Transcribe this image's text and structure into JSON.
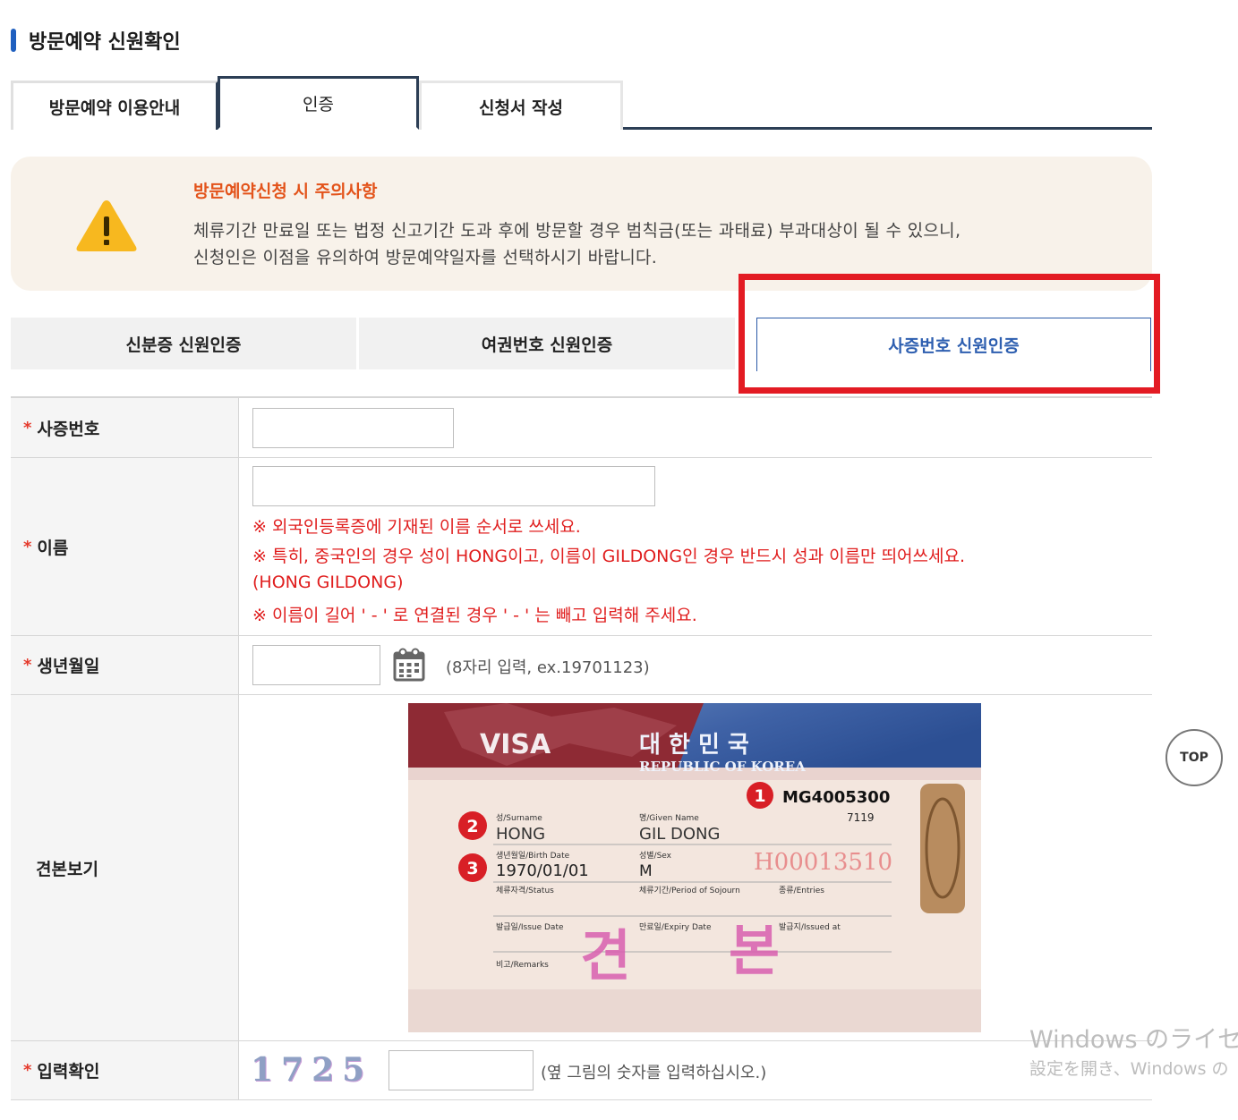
{
  "page_title": "방문예약 신원확인",
  "tabs": [
    {
      "label": "방문예약 이용안내"
    },
    {
      "label": "인증"
    },
    {
      "label": "신청서 작성"
    }
  ],
  "notice": {
    "title": "방문예약신청 시 주의사항",
    "line1": "체류기간 만료일 또는 법정 신고기간 도과 후에 방문할 경우 범칙금(또는 과태료) 부과대상이 될 수 있으니,",
    "line2": "신청인은 이점을 유의하여 방문예약일자를 선택하시기 바랍니다."
  },
  "auth_tabs": [
    {
      "label": "신분증 신원인증"
    },
    {
      "label": "여권번호 신원인증"
    },
    {
      "label": "사증번호 신원인증"
    }
  ],
  "form": {
    "required_mark": "*",
    "visa_number": {
      "label": "사증번호",
      "value": ""
    },
    "name": {
      "label": "이름",
      "value": "",
      "hint1": "※ 외국인등록증에 기재된 이름 순서로 쓰세요.",
      "hint2": "※ 특히, 중국인의 경우 성이 HONG이고, 이름이 GILDONG인 경우 반드시 성과 이름만 띄어쓰세요.",
      "hint3": "(HONG GILDONG)",
      "hint4": "※ 이름이 길어 ' - ' 로 연결된 경우 ' - ' 는 빼고 입력해 주세요."
    },
    "birth": {
      "label": "생년월일",
      "value": "",
      "hint": "(8자리 입력, ex.19701123)",
      "icon": "calendar-icon"
    },
    "sample": {
      "label": "견본보기",
      "visa": {
        "visa_word": "VISA",
        "country_kr": "대 한 민 국",
        "country_en": "REPUBLIC OF KOREA",
        "number": "MG4005300",
        "sub_number": "7119",
        "surname_label": "성/Surname",
        "surname": "HONG",
        "given_label": "명/Given Name",
        "given": "GIL DONG",
        "birth_label": "생년월일/Birth Date",
        "birth": "1970/01/01",
        "sex_label": "성별/Sex",
        "sex": "M",
        "serial": "H00013510",
        "status_label": "체류자격/Status",
        "period_label": "체류기간/Period of Sojourn",
        "entries_label": "종류/Entries",
        "issue_label": "발급일/Issue Date",
        "expiry_label": "만료일/Expiry Date",
        "issued_at_label": "발급지/Issued at",
        "remarks_label": "비고/Remarks",
        "stamp1": "견",
        "stamp2": "본",
        "markers": [
          "1",
          "2",
          "3"
        ]
      }
    },
    "captcha": {
      "label": "입력확인",
      "code": "1725",
      "value": "",
      "hint": "(옆 그림의 숫자를 입력하십시오.)"
    }
  },
  "top_button": "TOP",
  "watermark": {
    "line1": "Windows のライセン",
    "line2": "設定を開き、Windows の"
  }
}
